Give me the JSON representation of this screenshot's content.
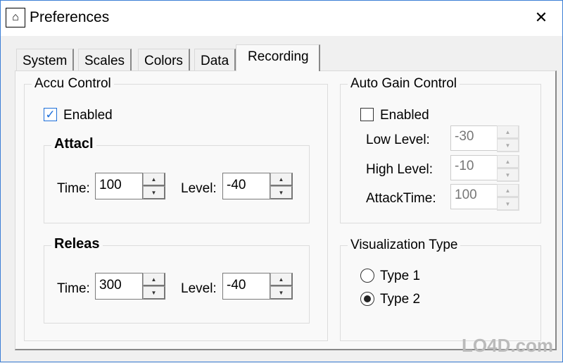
{
  "window": {
    "title": "Preferences",
    "close_icon": "close-icon",
    "app_icon": "app-logo-icon"
  },
  "tabs": [
    {
      "label": "System"
    },
    {
      "label": "Scales"
    },
    {
      "label": "Colors"
    },
    {
      "label": "Data"
    },
    {
      "label": "Recording",
      "active": true
    }
  ],
  "accu": {
    "title": "Accu Control",
    "enabled_label": "Enabled",
    "enabled": true,
    "attack": {
      "title": "Attacl",
      "time_label": "Time:",
      "time": "100",
      "level_label": "Level:",
      "level": "-40"
    },
    "release": {
      "title": "Releas",
      "time_label": "Time:",
      "time": "300",
      "level_label": "Level:",
      "level": "-40"
    }
  },
  "agc": {
    "title": "Auto Gain Control",
    "enabled_label": "Enabled",
    "enabled": false,
    "low_label": "Low Level:",
    "low": "-30",
    "high_label": "High Level:",
    "high": "-10",
    "attack_label": "AttackTime:",
    "attack": "100"
  },
  "viz": {
    "title": "Visualization Type",
    "options": [
      {
        "label": "Type 1",
        "selected": false
      },
      {
        "label": "Type 2",
        "selected": true
      }
    ]
  },
  "watermark": "LO4D.com"
}
